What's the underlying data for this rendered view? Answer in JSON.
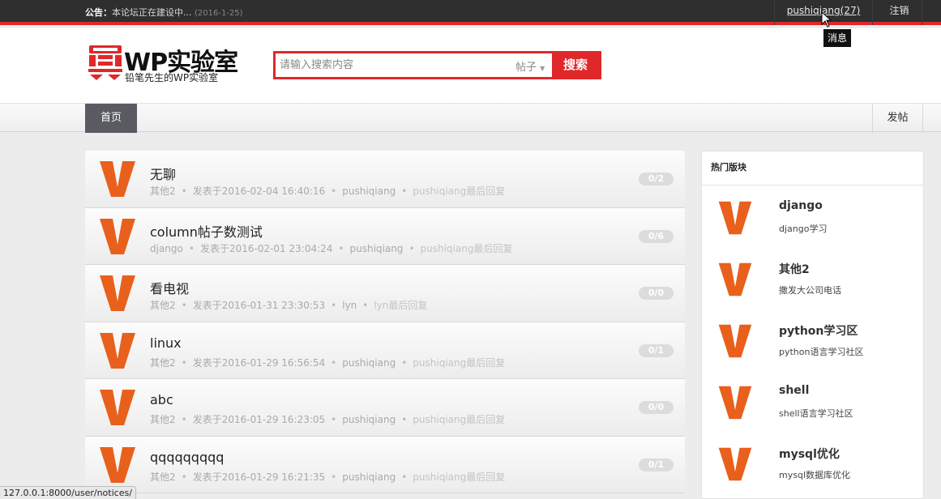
{
  "topbar": {
    "notice_label": "公告：",
    "notice_text": "本论坛正在建设中...",
    "notice_date": "(2016-1-25)",
    "user_link": "pushiqiang(27)",
    "logout": "注销",
    "tooltip": "消息"
  },
  "header": {
    "logo_title_latin": "WP",
    "logo_title_cn": "实验室",
    "logo_subtitle": "铅笔先生的WP实验室",
    "search_placeholder": "请输入搜索内容",
    "search_type": "帖子",
    "search_button": "搜索"
  },
  "nav": {
    "home": "首页",
    "post": "发帖"
  },
  "topics": [
    {
      "title": "无聊",
      "board": "其他2",
      "posted": "发表于2016-02-04 16:40:16",
      "author": "pushiqiang",
      "last_reply": "pushiqiang最后回复",
      "count": "0/2"
    },
    {
      "title": "column帖子数测试",
      "board": "django",
      "posted": "发表于2016-02-01 23:04:24",
      "author": "pushiqiang",
      "last_reply": "pushiqiang最后回复",
      "count": "0/6"
    },
    {
      "title": "看电视",
      "board": "其他2",
      "posted": "发表于2016-01-31 23:30:53",
      "author": "lyn",
      "last_reply": "lyn最后回复",
      "count": "0/0"
    },
    {
      "title": "linux",
      "board": "其他2",
      "posted": "发表于2016-01-29 16:56:54",
      "author": "pushiqiang",
      "last_reply": "pushiqiang最后回复",
      "count": "0/1"
    },
    {
      "title": "abc",
      "board": "其他2",
      "posted": "发表于2016-01-29 16:23:05",
      "author": "pushiqiang",
      "last_reply": "pushiqiang最后回复",
      "count": "0/0"
    },
    {
      "title": "qqqqqqqqq",
      "board": "其他2",
      "posted": "发表于2016-01-29 16:21:35",
      "author": "pushiqiang",
      "last_reply": "pushiqiang最后回复",
      "count": "0/1"
    }
  ],
  "hot": {
    "title": "热门版块",
    "boards": [
      {
        "name": "django",
        "desc": "django学习"
      },
      {
        "name": "其他2",
        "desc": "撒发大公司电话"
      },
      {
        "name": "python学习区",
        "desc": "python语言学习社区"
      },
      {
        "name": "shell",
        "desc": "shell语言学习社区"
      },
      {
        "name": "mysql优化",
        "desc": "mysql数据库优化"
      }
    ]
  },
  "statusbar": {
    "url": "127.0.0.1:8000/user/notices/"
  },
  "icons": {
    "topic": "v-letter-icon",
    "board": "v-letter-icon",
    "cursor": "mouse-pointer-icon",
    "logo": "wp-lab-logo-icon",
    "search_caret": "caret-down-icon"
  },
  "colors": {
    "accent": "#e0282a",
    "v_icon": "#e8601c",
    "topbar": "#2f2f2f",
    "nav_active": "#5a5a63"
  }
}
